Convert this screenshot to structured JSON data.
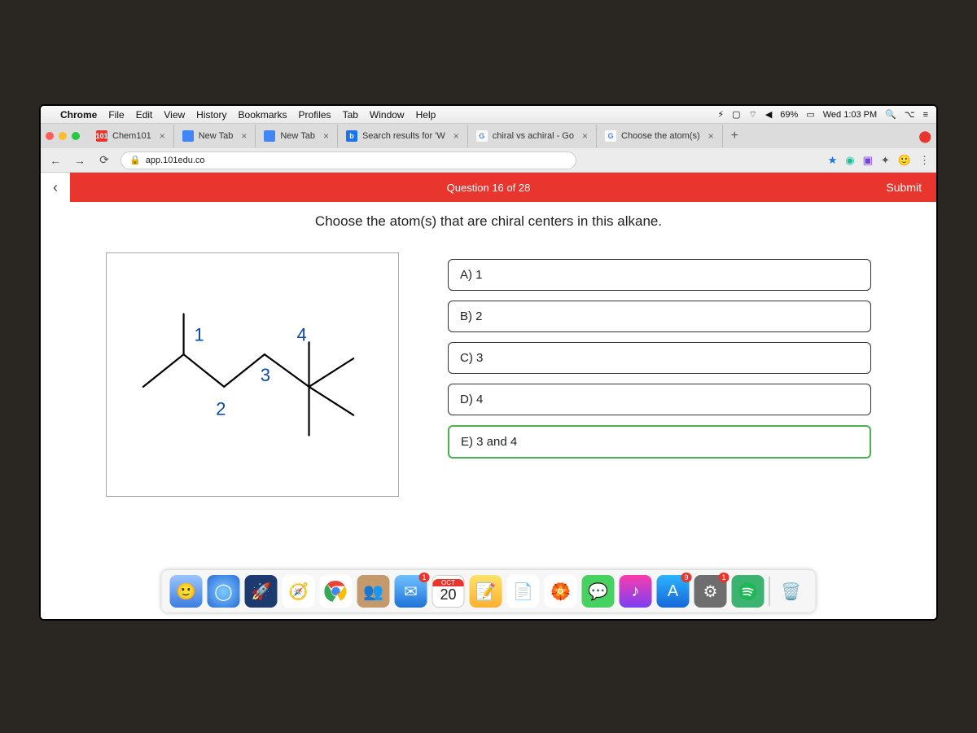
{
  "menubar": {
    "app": "Chrome",
    "items": [
      "File",
      "Edit",
      "View",
      "History",
      "Bookmarks",
      "Profiles",
      "Tab",
      "Window",
      "Help"
    ],
    "battery": "69%",
    "clock": "Wed 1:03 PM"
  },
  "tabs": [
    {
      "label": "Chem101",
      "favicon_bg": "#e8352e",
      "favicon_text": "101"
    },
    {
      "label": "New Tab",
      "favicon_bg": "#4285f4",
      "favicon_text": ""
    },
    {
      "label": "New Tab",
      "favicon_bg": "#4285f4",
      "favicon_text": ""
    },
    {
      "label": "Search results for 'W",
      "favicon_bg": "#1a73e8",
      "favicon_text": "b"
    },
    {
      "label": "chiral vs achiral - Go",
      "favicon_bg": "#ffffff",
      "favicon_text": "G"
    },
    {
      "label": "Choose the atom(s)",
      "favicon_bg": "#ffffff",
      "favicon_text": "G"
    }
  ],
  "addressbar": {
    "lock": "🔒",
    "url": "app.101edu.co"
  },
  "question": {
    "header_center": "Question 16 of 28",
    "submit_label": "Submit",
    "prompt": "Choose the atom(s) that are chiral centers in this alkane.",
    "atom_labels": {
      "a1": "1",
      "a2": "2",
      "a3": "3",
      "a4": "4"
    },
    "choices": [
      {
        "label": "A) 1",
        "selected": false
      },
      {
        "label": "B) 2",
        "selected": false
      },
      {
        "label": "C) 3",
        "selected": false
      },
      {
        "label": "D) 4",
        "selected": false
      },
      {
        "label": "E) 3 and 4",
        "selected": true
      }
    ]
  },
  "dock": {
    "calendar": {
      "month": "OCT",
      "day": "20"
    },
    "mail_badge": "1",
    "appstore_badge": "9",
    "prefs_badge": "1"
  }
}
